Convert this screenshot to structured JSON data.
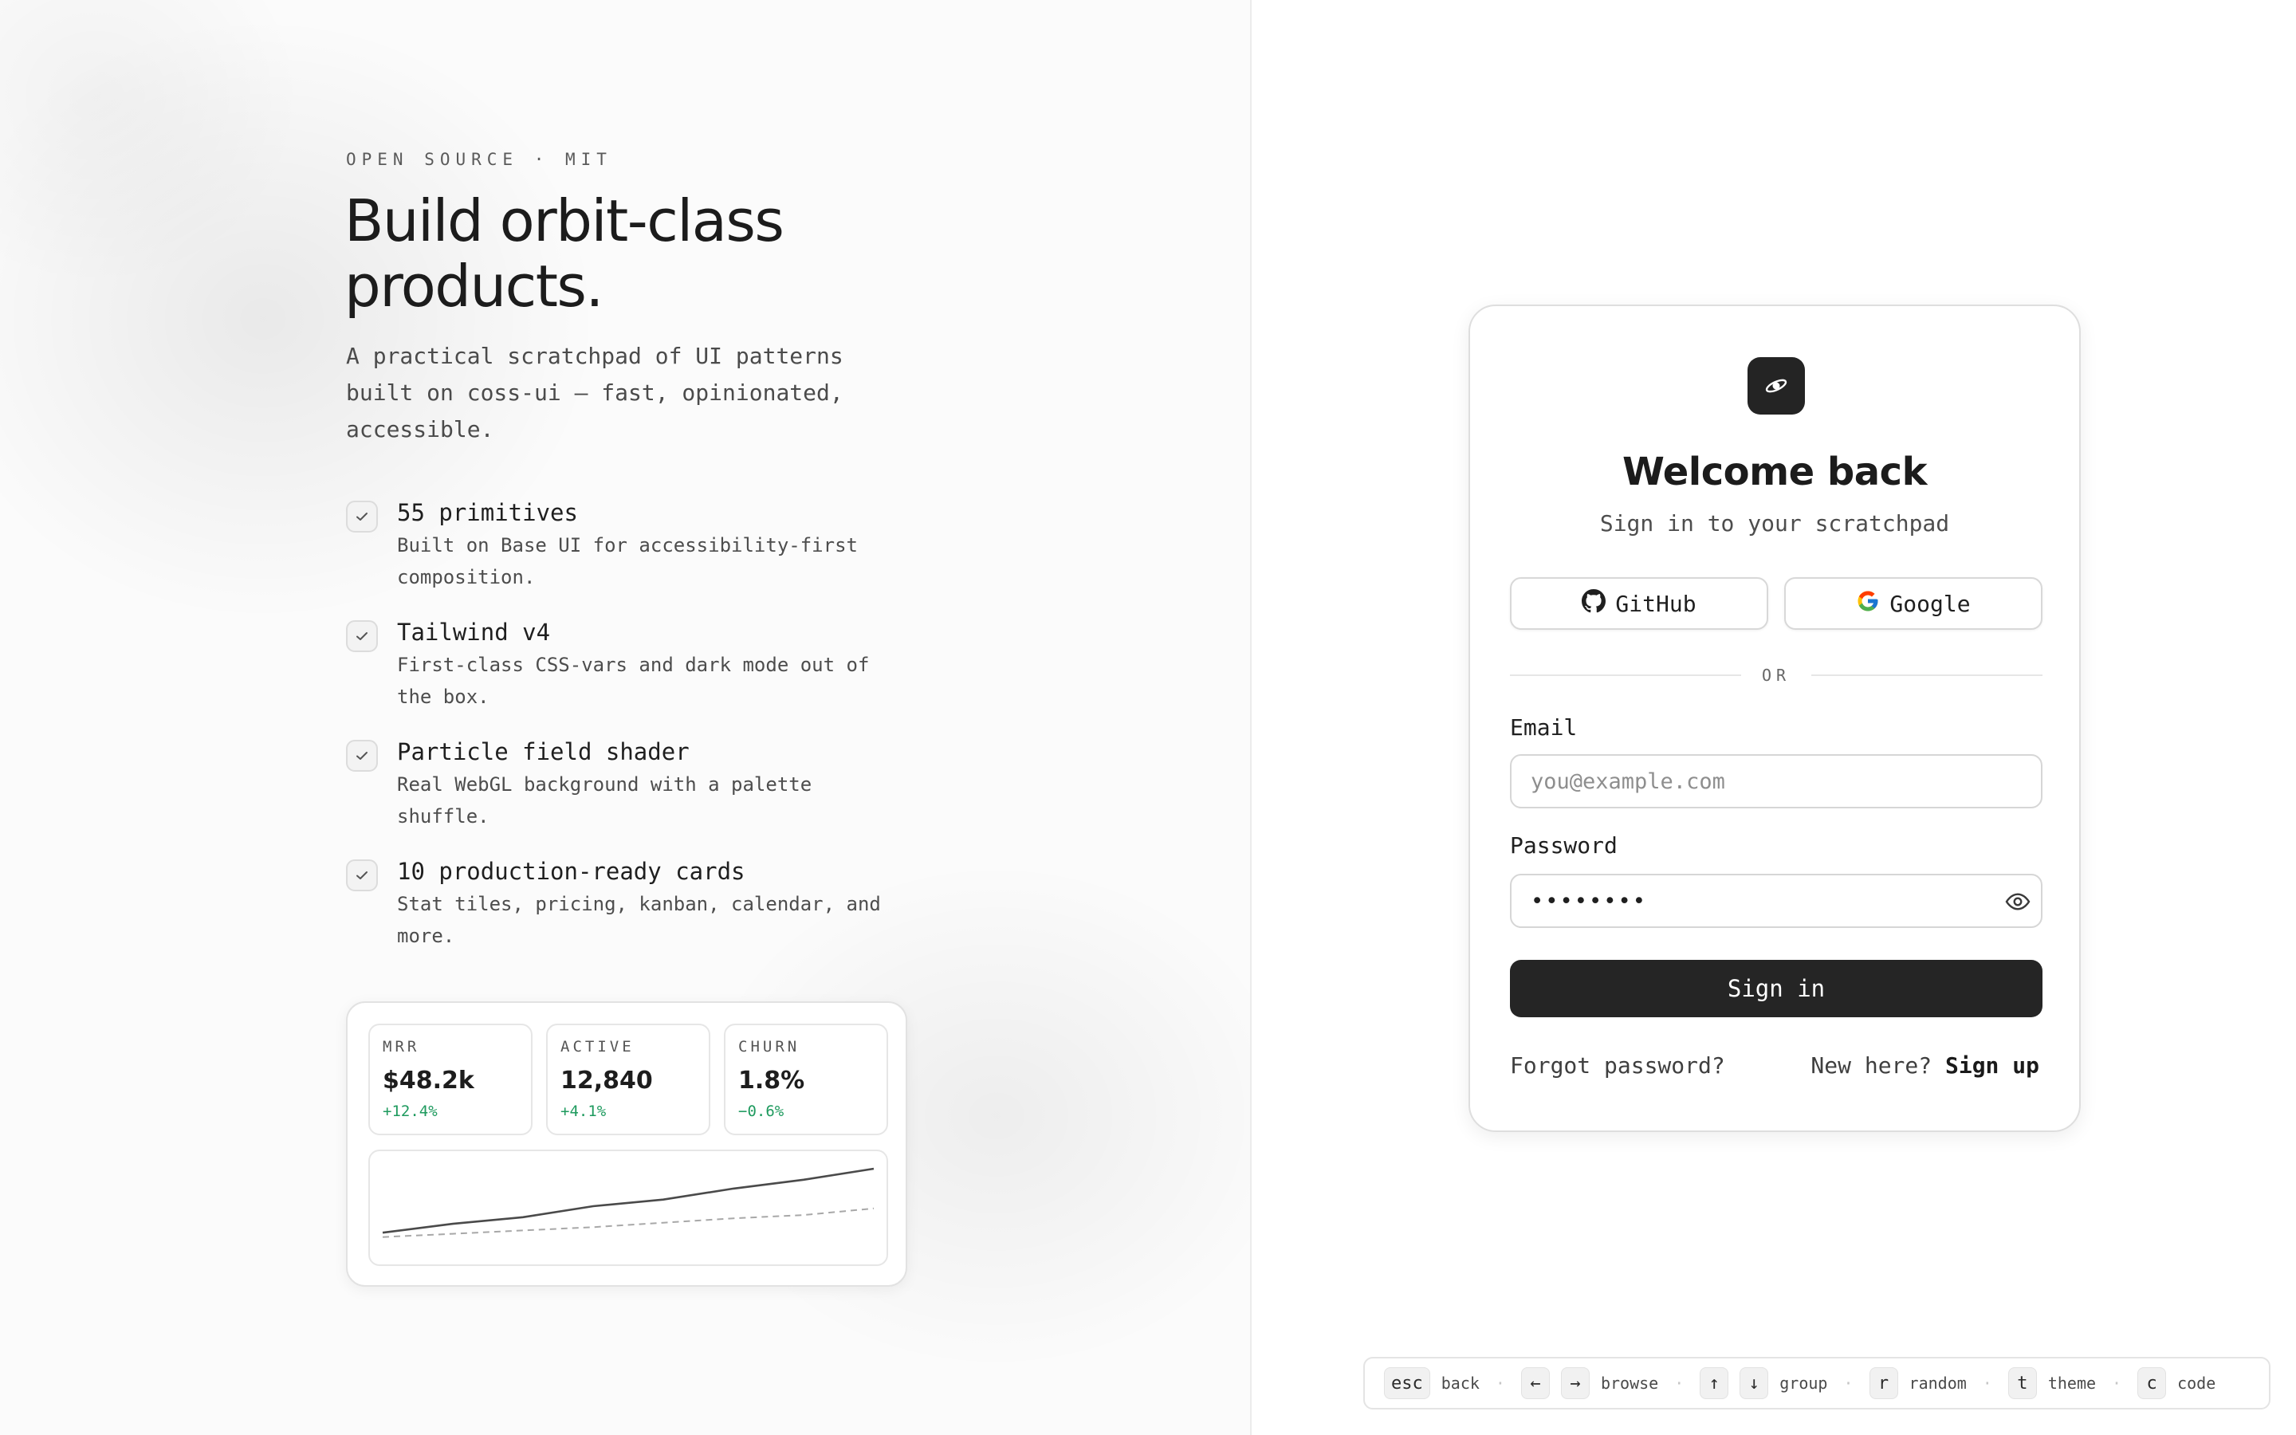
{
  "hero": {
    "eyebrow": "OPEN SOURCE · MIT",
    "headline": "Build orbit-class products.",
    "subcopy": "A practical scratchpad of UI patterns built on coss-ui — fast, opinionated, accessible."
  },
  "features": [
    {
      "title": "55 primitives",
      "desc": "Built on Base UI for accessibility-first composition."
    },
    {
      "title": "Tailwind v4",
      "desc": "First-class CSS-vars and dark mode out of the box."
    },
    {
      "title": "Particle field shader",
      "desc": "Real WebGL background with a palette shuffle."
    },
    {
      "title": "10 production-ready cards",
      "desc": "Stat tiles, pricing, kanban, calendar, and more."
    }
  ],
  "stats": [
    {
      "label": "MRR",
      "value": "$48.2k",
      "delta": "+12.4%",
      "delta_color": "#1e9a5e"
    },
    {
      "label": "ACTIVE",
      "value": "12,840",
      "delta": "+4.1%",
      "delta_color": "#1e9a5e"
    },
    {
      "label": "CHURN",
      "value": "1.8%",
      "delta": "−0.6%",
      "delta_color": "#1e9a5e"
    }
  ],
  "chart_data": {
    "type": "line",
    "series": [
      {
        "style": "solid",
        "values": [
          10,
          18,
          24,
          34,
          40,
          50,
          58,
          68
        ]
      },
      {
        "style": "dashed",
        "values": [
          6,
          9,
          12,
          15,
          19,
          23,
          26,
          32
        ]
      }
    ]
  },
  "login": {
    "title": "Welcome back",
    "subtitle": "Sign in to your scratchpad",
    "github_label": "GitHub",
    "google_label": "Google",
    "divider": "OR",
    "email_label": "Email",
    "email_placeholder": "you@example.com",
    "password_label": "Password",
    "password_value": "••••••••",
    "submit_label": "Sign in",
    "forgot_label": "Forgot password?",
    "new_here": "New here?",
    "signup_label": "Sign up"
  },
  "shortcuts": [
    {
      "keys": [
        "esc"
      ],
      "label": "back"
    },
    {
      "keys": [
        "←",
        "→"
      ],
      "label": "browse"
    },
    {
      "keys": [
        "↑",
        "↓"
      ],
      "label": "group"
    },
    {
      "keys": [
        "r"
      ],
      "label": "random"
    },
    {
      "keys": [
        "t"
      ],
      "label": "theme"
    },
    {
      "keys": [
        "c"
      ],
      "label": "code"
    }
  ],
  "colors": {
    "accent_dark": "#252525",
    "positive": "#1e9a5e",
    "google_blue": "#4285F4",
    "google_red": "#EA4335",
    "google_yellow": "#FBBC05",
    "google_green": "#34A853"
  },
  "icons": {
    "logo": "orbit-icon",
    "github": "github-icon",
    "google": "google-icon",
    "check": "check-icon",
    "password_toggle": "eye-icon"
  }
}
